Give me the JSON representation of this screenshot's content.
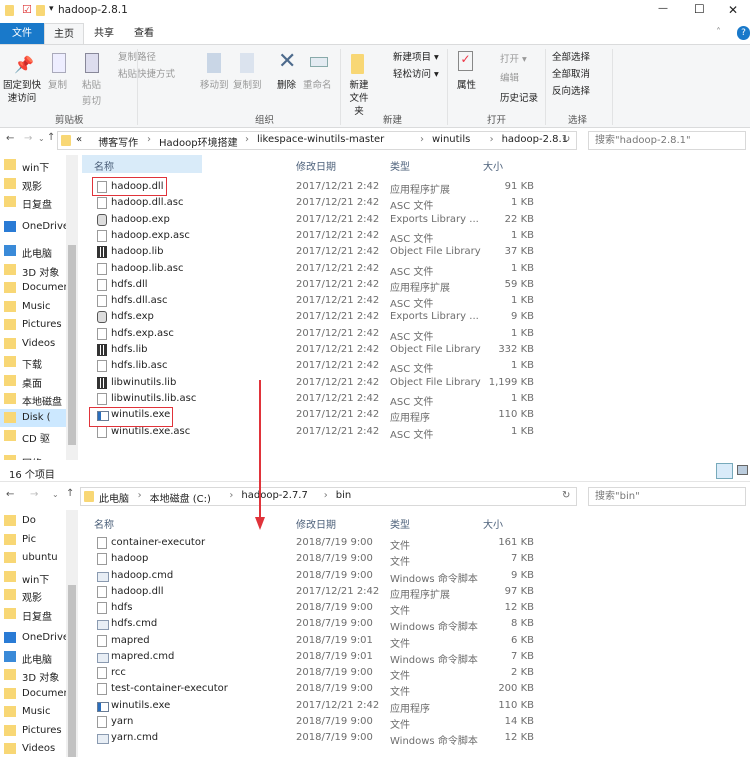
{
  "window": {
    "title": "hadoop-2.8.1",
    "min": "—",
    "max": "☐",
    "close": "✕"
  },
  "tabs": [
    {
      "label": "文件"
    },
    {
      "label": "主页"
    },
    {
      "label": "共享"
    },
    {
      "label": "查看"
    }
  ],
  "ribbon": {
    "pin": "固定到快速访问",
    "copy": "复制",
    "paste": "粘贴",
    "copy_path": "复制路径",
    "paste_shortcut": "粘贴快捷方式",
    "cut": "剪切",
    "group_clipboard": "剪贴板",
    "move_to": "移动到",
    "copy_to": "复制到",
    "delete": "删除",
    "rename": "重命名",
    "group_organize": "组织",
    "new_folder": "新建文件夹",
    "new_item": "新建项目 ▾",
    "easy_access": "轻松访问 ▾",
    "group_new": "新建",
    "properties": "属性",
    "open": "打开 ▾",
    "edit": "编辑",
    "history": "历史记录",
    "group_open": "打开",
    "select_all": "全部选择",
    "select_none": "全部取消",
    "invert": "反向选择",
    "group_select": "选择"
  },
  "top": {
    "breadcrumb": [
      "«",
      "博客写作",
      "Hadoop环境搭建",
      "likespace-winutils-master",
      "winutils",
      "hadoop-2.8.1"
    ],
    "search_placeholder": "搜索\"hadoop-2.8.1\"",
    "nav": [
      "win下",
      "观影",
      "日复盘",
      "OneDrive",
      "此电脑",
      "3D 对象",
      "Documents",
      "Music",
      "Pictures",
      "Videos",
      "下载",
      "桌面",
      "本地磁盘",
      "Disk (",
      "CD 驱",
      "网络"
    ],
    "columns": {
      "name": "名称",
      "date": "修改日期",
      "type": "类型",
      "size": "大小"
    },
    "files": [
      {
        "name": "hadoop.dll",
        "date": "2017/12/21 2:42",
        "type": "应用程序扩展",
        "size": "91 KB",
        "icon": "dll"
      },
      {
        "name": "hadoop.dll.asc",
        "date": "2017/12/21 2:42",
        "type": "ASC 文件",
        "size": "1 KB",
        "icon": "file"
      },
      {
        "name": "hadoop.exp",
        "date": "2017/12/21 2:42",
        "type": "Exports Library ...",
        "size": "22 KB",
        "icon": "exp"
      },
      {
        "name": "hadoop.exp.asc",
        "date": "2017/12/21 2:42",
        "type": "ASC 文件",
        "size": "1 KB",
        "icon": "file"
      },
      {
        "name": "hadoop.lib",
        "date": "2017/12/21 2:42",
        "type": "Object File Library",
        "size": "37 KB",
        "icon": "lib"
      },
      {
        "name": "hadoop.lib.asc",
        "date": "2017/12/21 2:42",
        "type": "ASC 文件",
        "size": "1 KB",
        "icon": "file"
      },
      {
        "name": "hdfs.dll",
        "date": "2017/12/21 2:42",
        "type": "应用程序扩展",
        "size": "59 KB",
        "icon": "dll"
      },
      {
        "name": "hdfs.dll.asc",
        "date": "2017/12/21 2:42",
        "type": "ASC 文件",
        "size": "1 KB",
        "icon": "file"
      },
      {
        "name": "hdfs.exp",
        "date": "2017/12/21 2:42",
        "type": "Exports Library ...",
        "size": "9 KB",
        "icon": "exp"
      },
      {
        "name": "hdfs.exp.asc",
        "date": "2017/12/21 2:42",
        "type": "ASC 文件",
        "size": "1 KB",
        "icon": "file"
      },
      {
        "name": "hdfs.lib",
        "date": "2017/12/21 2:42",
        "type": "Object File Library",
        "size": "332 KB",
        "icon": "lib"
      },
      {
        "name": "hdfs.lib.asc",
        "date": "2017/12/21 2:42",
        "type": "ASC 文件",
        "size": "1 KB",
        "icon": "file"
      },
      {
        "name": "libwinutils.lib",
        "date": "2017/12/21 2:42",
        "type": "Object File Library",
        "size": "1,199 KB",
        "icon": "lib"
      },
      {
        "name": "libwinutils.lib.asc",
        "date": "2017/12/21 2:42",
        "type": "ASC 文件",
        "size": "1 KB",
        "icon": "file"
      },
      {
        "name": "winutils.exe",
        "date": "2017/12/21 2:42",
        "type": "应用程序",
        "size": "110 KB",
        "icon": "exe"
      },
      {
        "name": "winutils.exe.asc",
        "date": "2017/12/21 2:42",
        "type": "ASC 文件",
        "size": "1 KB",
        "icon": "file"
      }
    ],
    "status": "16 个项目"
  },
  "bottom": {
    "breadcrumb": [
      "此电脑",
      "本地磁盘 (C:)",
      "hadoop-2.7.7",
      "bin"
    ],
    "search_placeholder": "搜索\"bin\"",
    "nav": [
      "Do",
      "Pic",
      "ubuntu",
      "win下",
      "观影",
      "日复盘",
      "OneDrive",
      "此电脑",
      "3D 对象",
      "Documents",
      "Music",
      "Pictures",
      "Videos"
    ],
    "columns": {
      "name": "名称",
      "date": "修改日期",
      "type": "类型",
      "size": "大小"
    },
    "files": [
      {
        "name": "container-executor",
        "date": "2018/7/19 9:00",
        "type": "文件",
        "size": "161 KB",
        "icon": "file"
      },
      {
        "name": "hadoop",
        "date": "2018/7/19 9:00",
        "type": "文件",
        "size": "7 KB",
        "icon": "file"
      },
      {
        "name": "hadoop.cmd",
        "date": "2018/7/19 9:00",
        "type": "Windows 命令脚本",
        "size": "9 KB",
        "icon": "cmd"
      },
      {
        "name": "hadoop.dll",
        "date": "2017/12/21 2:42",
        "type": "应用程序扩展",
        "size": "97 KB",
        "icon": "dll"
      },
      {
        "name": "hdfs",
        "date": "2018/7/19 9:00",
        "type": "文件",
        "size": "12 KB",
        "icon": "file"
      },
      {
        "name": "hdfs.cmd",
        "date": "2018/7/19 9:00",
        "type": "Windows 命令脚本",
        "size": "8 KB",
        "icon": "cmd"
      },
      {
        "name": "mapred",
        "date": "2018/7/19 9:01",
        "type": "文件",
        "size": "6 KB",
        "icon": "file"
      },
      {
        "name": "mapred.cmd",
        "date": "2018/7/19 9:01",
        "type": "Windows 命令脚本",
        "size": "7 KB",
        "icon": "cmd"
      },
      {
        "name": "rcc",
        "date": "2018/7/19 9:00",
        "type": "文件",
        "size": "2 KB",
        "icon": "file"
      },
      {
        "name": "test-container-executor",
        "date": "2018/7/19 9:00",
        "type": "文件",
        "size": "200 KB",
        "icon": "file"
      },
      {
        "name": "winutils.exe",
        "date": "2017/12/21 2:42",
        "type": "应用程序",
        "size": "110 KB",
        "icon": "exe"
      },
      {
        "name": "yarn",
        "date": "2018/7/19 9:00",
        "type": "文件",
        "size": "14 KB",
        "icon": "file"
      },
      {
        "name": "yarn.cmd",
        "date": "2018/7/19 9:00",
        "type": "Windows 命令脚本",
        "size": "12 KB",
        "icon": "cmd"
      }
    ]
  },
  "colors": {
    "accent": "#1979ca",
    "highlight": "#e0333a",
    "header_selected": "#d9ebf9"
  }
}
